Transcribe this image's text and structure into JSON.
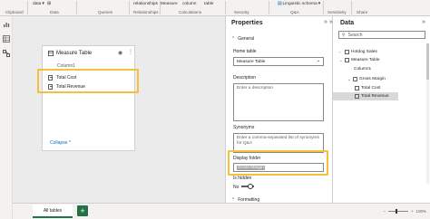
{
  "ribbon": {
    "groups": [
      "Clipboard",
      "Data",
      "Queries",
      "Relationships",
      "Calculations",
      "Security",
      "Q&A",
      "Sensitivity",
      "Share"
    ],
    "top_items": {
      "data": "data",
      "relationships": "relationships",
      "measure": "Measure",
      "column": "column",
      "table": "table",
      "linguistic": "Linguistic schema"
    }
  },
  "model_card": {
    "title": "Measure Table",
    "column": "Column1",
    "measures": [
      "Total Cost",
      "Total Revenue"
    ],
    "collapse": "Collapse"
  },
  "tabs": {
    "all_tables": "All tables",
    "add": "+"
  },
  "zoom": {
    "value": "100%"
  },
  "properties": {
    "title": "Properties",
    "general": "General",
    "home_table_label": "Home table",
    "home_table_value": "Measure Table",
    "description_label": "Description",
    "description_placeholder": "Enter a description",
    "synonyms_label": "Synonyms",
    "synonyms_placeholder": "Enter a comma-separated list of synonyms for Q&A",
    "display_folder_label": "Display folder",
    "display_folder_value": "Gross Margin",
    "is_hidden_label": "Is hidden",
    "is_hidden_value": "No",
    "formatting": "Formatting"
  },
  "data_pane": {
    "title": "Data",
    "search_placeholder": "Search",
    "tree": [
      {
        "label": "Hotdog Sales"
      },
      {
        "label": "Measure Table"
      },
      {
        "label": "Column1"
      },
      {
        "label": "Gross Margin"
      },
      {
        "label": "Total Cost"
      },
      {
        "label": "Total Revenue"
      }
    ]
  },
  "colors": {
    "accent": "#217346",
    "highlight": "#f5c040",
    "link": "#0f6cbd"
  }
}
